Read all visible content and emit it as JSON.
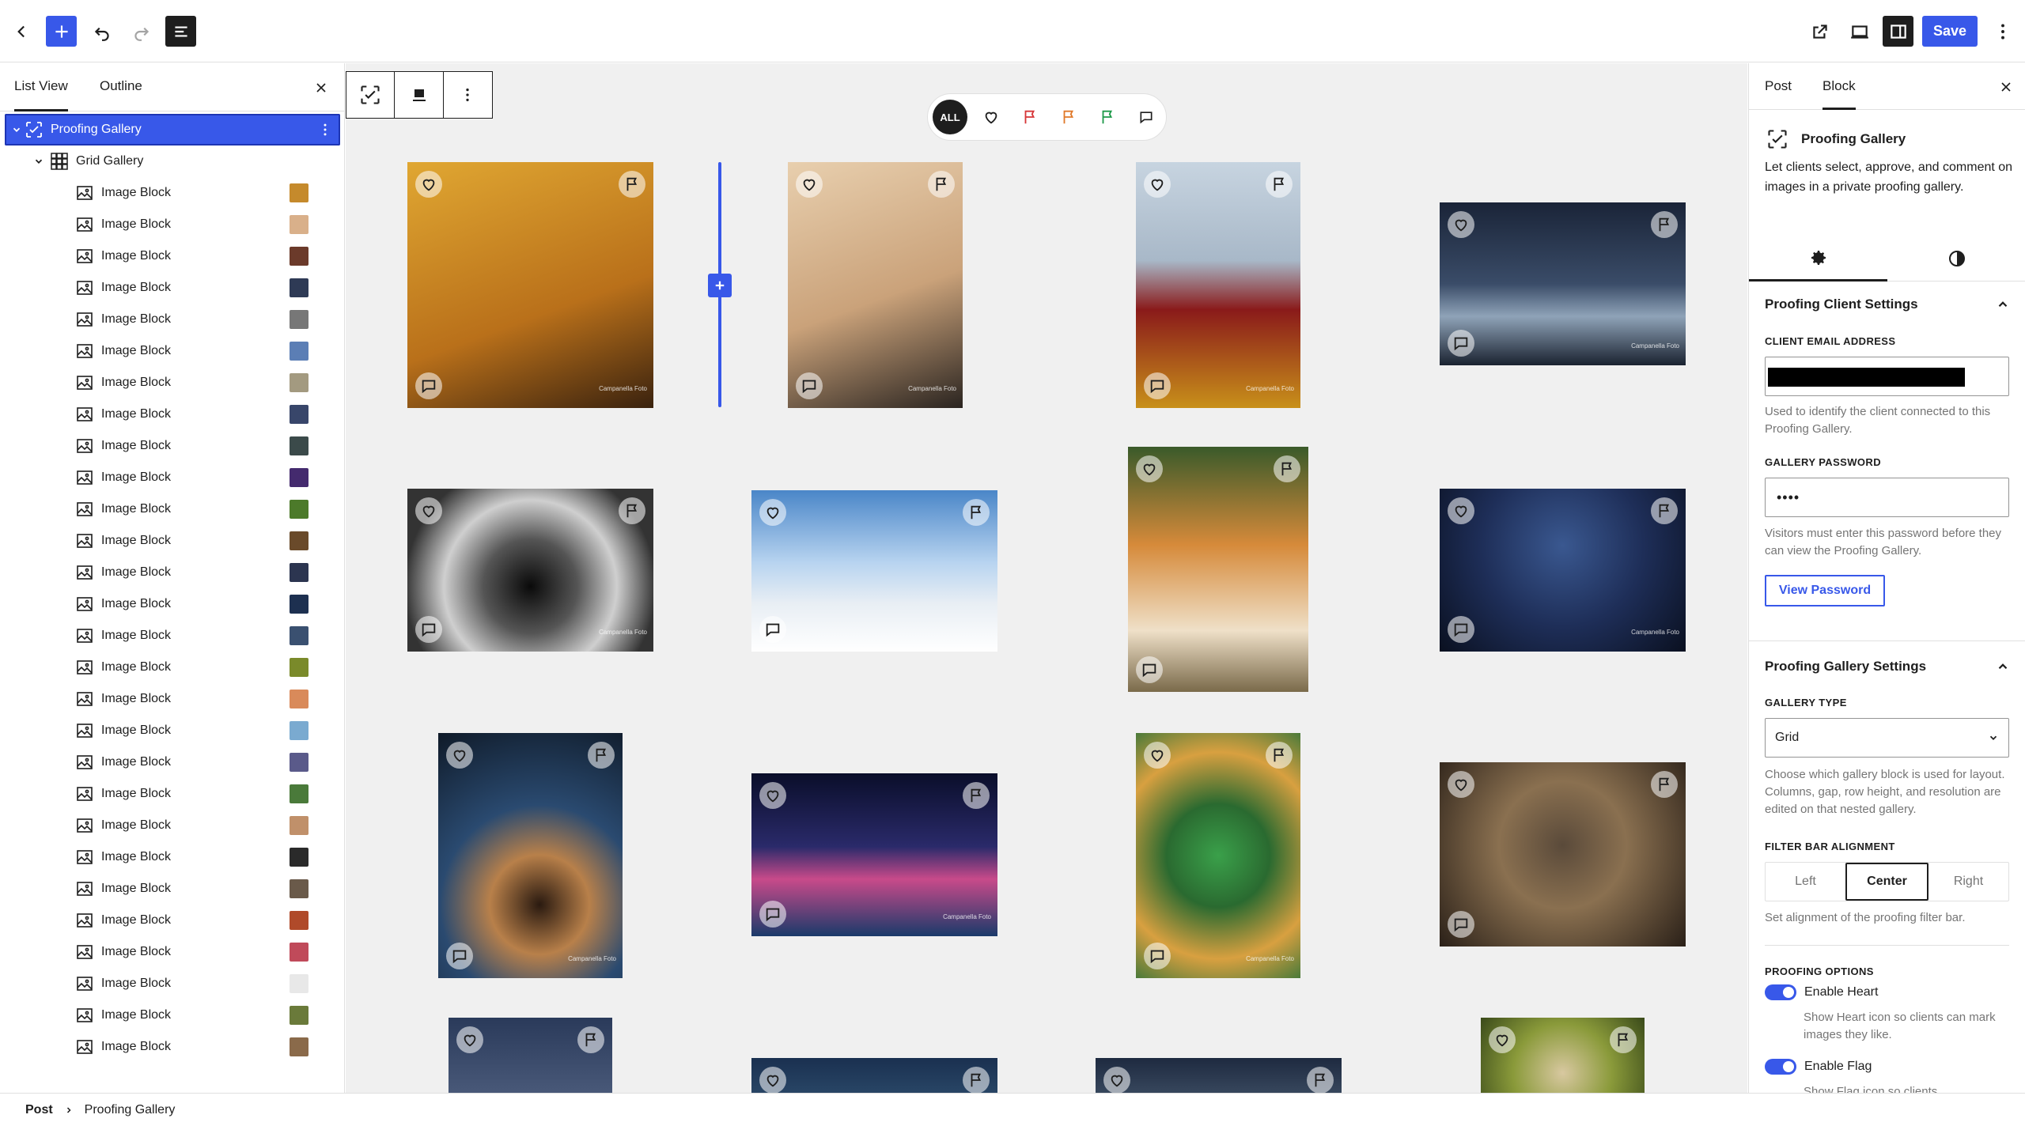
{
  "toolbar": {
    "save_label": "Save",
    "icons": [
      "back-chevron-icon",
      "plus-icon",
      "undo-icon",
      "redo-icon",
      "document-overview-icon",
      "external-link-icon",
      "device-preview-icon",
      "sidebar-toggle-icon",
      "more-vertical-icon"
    ]
  },
  "list_view": {
    "tabs": [
      "List View",
      "Outline"
    ],
    "root": {
      "label": "Proofing Gallery"
    },
    "gallery": {
      "label": "Grid Gallery"
    },
    "items": [
      {
        "label": "Image Block",
        "thumb": "#c58a2c"
      },
      {
        "label": "Image Block",
        "thumb": "#d9b08a"
      },
      {
        "label": "Image Block",
        "thumb": "#6b3a2a"
      },
      {
        "label": "Image Block",
        "thumb": "#2e3a55"
      },
      {
        "label": "Image Block",
        "thumb": "#777777"
      },
      {
        "label": "Image Block",
        "thumb": "#5b7eb5"
      },
      {
        "label": "Image Block",
        "thumb": "#a39a80"
      },
      {
        "label": "Image Block",
        "thumb": "#38466a"
      },
      {
        "label": "Image Block",
        "thumb": "#3b4a4a"
      },
      {
        "label": "Image Block",
        "thumb": "#442a6e"
      },
      {
        "label": "Image Block",
        "thumb": "#4c7a2a"
      },
      {
        "label": "Image Block",
        "thumb": "#6a4a2a"
      },
      {
        "label": "Image Block",
        "thumb": "#2c3550"
      },
      {
        "label": "Image Block",
        "thumb": "#1d3050"
      },
      {
        "label": "Image Block",
        "thumb": "#3a5070"
      },
      {
        "label": "Image Block",
        "thumb": "#7a8a2a"
      },
      {
        "label": "Image Block",
        "thumb": "#d98a5a"
      },
      {
        "label": "Image Block",
        "thumb": "#7aaad0"
      },
      {
        "label": "Image Block",
        "thumb": "#5a5a8a"
      },
      {
        "label": "Image Block",
        "thumb": "#4a7a3a"
      },
      {
        "label": "Image Block",
        "thumb": "#c0906a"
      },
      {
        "label": "Image Block",
        "thumb": "#2a2a2a"
      },
      {
        "label": "Image Block",
        "thumb": "#6a5a4a"
      },
      {
        "label": "Image Block",
        "thumb": "#b04a2a"
      },
      {
        "label": "Image Block",
        "thumb": "#c04a5a"
      },
      {
        "label": "Image Block",
        "thumb": "#e8e8e8"
      },
      {
        "label": "Image Block",
        "thumb": "#6a7a3a"
      },
      {
        "label": "Image Block",
        "thumb": "#8a6a4a"
      }
    ]
  },
  "canvas": {
    "filter_bar": {
      "all_label": "ALL",
      "filters": [
        {
          "name": "heart-filter",
          "color": "#1e1e1e"
        },
        {
          "name": "red-flag-filter",
          "color": "#d63638"
        },
        {
          "name": "orange-flag-filter",
          "color": "#e0792a"
        },
        {
          "name": "green-flag-filter",
          "color": "#1f9a4a"
        },
        {
          "name": "comment-filter",
          "color": "#1e1e1e"
        }
      ]
    },
    "photos": [
      {
        "name": "butterfly-portrait-photo",
        "bg": "linear-gradient(160deg,#e0a732 0%,#b9701a 60%,#3a220e 100%)",
        "watermark": "Campanella Foto"
      },
      {
        "name": "butterfly-mask-photo",
        "bg": "linear-gradient(160deg,#e8cfae 0%,#caa27a 55%,#2a2420 100%)",
        "watermark": "Campanella Foto"
      },
      {
        "name": "afro-portrait-photo",
        "bg": "linear-gradient(180deg,#c7d4e0 0%,#a8b8c8 40%,#8a1a1a 60%,#c8901a 100%)",
        "watermark": "Campanella Foto"
      },
      {
        "name": "iceberg-night-photo",
        "bg": "linear-gradient(180deg,#1a2438 0%,#3a4c68 50%,#8fa3b8 70%,#1a2230 100%)",
        "watermark": "Campanella Foto"
      },
      {
        "name": "spiral-staircase-photo",
        "bg": "radial-gradient(circle at 50% 60%,#0a0a0a 0%,#555 30%,#cfcfcf 55%,#333 80%)",
        "watermark": "Campanella Foto"
      },
      {
        "name": "alpine-church-photo",
        "bg": "linear-gradient(180deg,#4a86c8 0%,#b8d4f0 45%,#e8eef4 70%,#ffffff 100%)",
        "watermark": ""
      },
      {
        "name": "tiger-photo",
        "bg": "linear-gradient(180deg,#3a5a2a 0%,#d68a3a 40%,#efe0c8 75%,#7a6a4a 100%)",
        "watermark": ""
      },
      {
        "name": "star-trails-photo",
        "bg": "radial-gradient(circle at 50% 35%,#3a5890 0%,#1e2e58 50%,#0a1020 100%)",
        "watermark": "Campanella Foto"
      },
      {
        "name": "blue-staircase-photo",
        "bg": "radial-gradient(circle at 55% 70%,#2a1a10 0%,#b8804a 25%,#2a4a70 50%,#0f1a28 100%)",
        "watermark": "Campanella Foto"
      },
      {
        "name": "city-night-photo",
        "bg": "linear-gradient(180deg,#0a0e2a 0%,#2a2a6a 45%,#c84a8a 65%,#1a3a6a 100%)",
        "watermark": "Campanella Foto"
      },
      {
        "name": "green-beetle-photo",
        "bg": "radial-gradient(circle at 50% 50%,#3aa04a 0%,#2a6a30 35%,#d8a040 70%,#4a7a3a 100%)",
        "watermark": "Campanella Foto"
      },
      {
        "name": "owl-photo",
        "bg": "radial-gradient(circle at 50% 45%,#5a4a3a 0%,#8a7050 40%,#2a2018 100%)",
        "watermark": ""
      },
      {
        "name": "milky-way-photo",
        "bg": "linear-gradient(180deg,#2a3a5a 0%,#4a5a7a 100%)",
        "watermark": ""
      },
      {
        "name": "dark-sky-photo-1",
        "bg": "linear-gradient(180deg,#1a3050 0%,#2a4868 100%)",
        "watermark": ""
      },
      {
        "name": "dark-sky-photo-2",
        "bg": "linear-gradient(180deg,#1e2a40 0%,#3a4a60 100%)",
        "watermark": ""
      },
      {
        "name": "mushroom-photo",
        "bg": "radial-gradient(circle at 50% 70%,#d8c8a0 0%,#8a9a3a 50%,#3a4a1a 100%)",
        "watermark": ""
      }
    ]
  },
  "sidebar": {
    "tabs": [
      "Post",
      "Block"
    ],
    "block_card": {
      "title": "Proofing Gallery",
      "description": "Let clients select, approve, and comment on images in a private proofing gallery."
    },
    "client_settings": {
      "title": "Proofing Client Settings",
      "email_label": "CLIENT EMAIL ADDRESS",
      "email_help": "Used to identify the client connected to this Proofing Gallery.",
      "password_label": "GALLERY PASSWORD",
      "password_value": "••••",
      "password_help": "Visitors must enter this password before they can view the Proofing Gallery.",
      "view_password_label": "View Password"
    },
    "gallery_settings": {
      "title": "Proofing Gallery Settings",
      "type_label": "GALLERY TYPE",
      "type_value": "Grid",
      "type_help": "Choose which gallery block is used for layout. Columns, gap, row height, and resolution are edited on that nested gallery.",
      "alignment_label": "FILTER BAR ALIGNMENT",
      "alignment_options": [
        "Left",
        "Center",
        "Right"
      ],
      "alignment_selected": "Center",
      "alignment_help": "Set alignment of the proofing filter bar.",
      "options_label": "PROOFING OPTIONS",
      "enable_heart": "Enable Heart",
      "enable_heart_help": "Show Heart icon so clients can mark images they like.",
      "enable_flag": "Enable Flag",
      "enable_flag_help": "Show Flag icon so clients"
    }
  },
  "breadcrumb": {
    "items": [
      "Post",
      "Proofing Gallery"
    ]
  }
}
